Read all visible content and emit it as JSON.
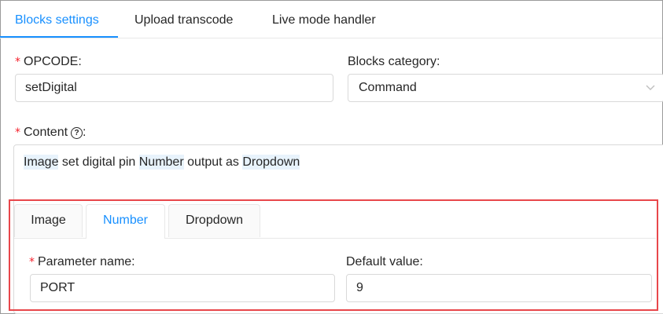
{
  "top_tabs": [
    {
      "label": "Blocks settings",
      "active": true
    },
    {
      "label": "Upload transcode",
      "active": false
    },
    {
      "label": "Live mode handler",
      "active": false
    }
  ],
  "form": {
    "required_mark": "*",
    "opcode_label": "OPCODE:",
    "opcode_value": "setDigital",
    "category_label": "Blocks category:",
    "category_value": "Command",
    "content_label": "Content",
    "content_colon": ":",
    "help_icon_glyph": "?",
    "content_parts": {
      "p1": "Image",
      "p2": " set digital pin ",
      "p3": "Number",
      "p4": " output as ",
      "p5": "Dropdown"
    }
  },
  "param_tabs": [
    {
      "label": "Image",
      "active": false
    },
    {
      "label": "Number",
      "active": true
    },
    {
      "label": "Dropdown",
      "active": false
    }
  ],
  "param": {
    "name_label": "Parameter name:",
    "name_value": "PORT",
    "default_label": "Default value:",
    "default_value": "9"
  },
  "colors": {
    "accent": "#1890ff",
    "required": "#f5222d",
    "highlight_border": "#e8474b",
    "tag_background": "#e8f3fc"
  },
  "icons": {
    "select_arrow": "chevron-down-icon",
    "content_help": "question-circle-icon"
  }
}
